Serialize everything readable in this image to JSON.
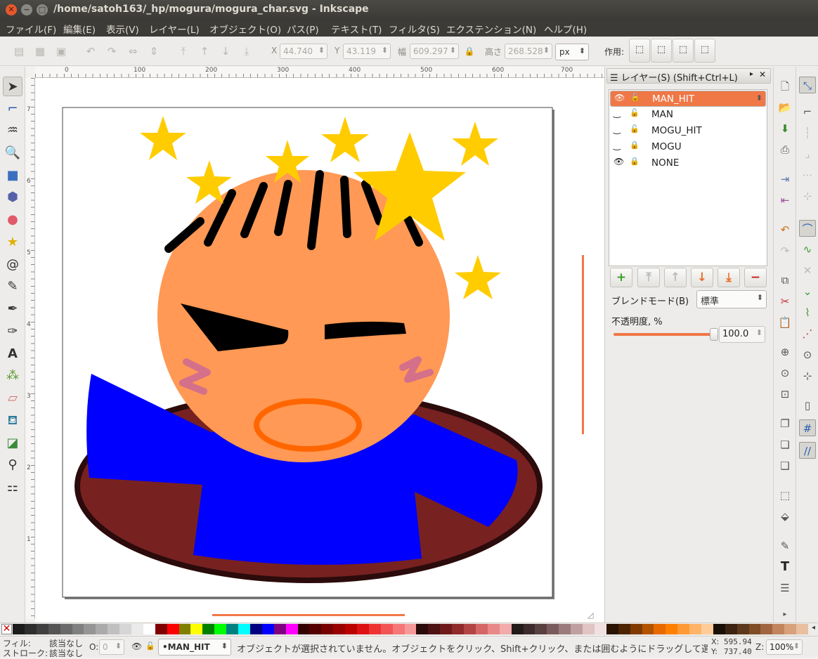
{
  "window": {
    "title": "/home/satoh163/_hp/mogura/mogura_char.svg - Inkscape"
  },
  "menu": [
    "ファイル(F)",
    "編集(E)",
    "表示(V)",
    "レイヤー(L)",
    "オブジェクト(O)",
    "パス(P)",
    "テキスト(T)",
    "フィルタ(S)",
    "エクステンション(N)",
    "ヘルプ(H)"
  ],
  "toolbar": {
    "x_label": "X",
    "x_value": "44.740",
    "y_label": "Y",
    "y_value": "43.119",
    "w_label": "幅",
    "w_value": "609.297",
    "h_label": "高さ",
    "h_value": "268.528",
    "unit": "px",
    "affect_label": "作用:"
  },
  "ruler": {
    "h_ticks": [
      "0",
      "100",
      "200",
      "300",
      "400",
      "500",
      "600",
      "700"
    ],
    "v_ticks": [
      "7",
      "6",
      "5",
      "4",
      "3",
      "2",
      "1"
    ]
  },
  "layers_panel": {
    "title": "レイヤー(S) (Shift+Ctrl+L)",
    "layers": [
      {
        "name": "MAN_HIT",
        "selected": true,
        "visible": true,
        "locked": false
      },
      {
        "name": "MAN",
        "selected": false,
        "visible": false,
        "locked": false
      },
      {
        "name": "MOGU_HIT",
        "selected": false,
        "visible": false,
        "locked": false
      },
      {
        "name": "MOGU",
        "selected": false,
        "visible": false,
        "locked": true
      },
      {
        "name": "NONE",
        "selected": false,
        "visible": true,
        "locked": true
      }
    ],
    "blend_label": "ブレンドモード(B)",
    "blend_value": "標準",
    "opacity_label": "不透明度, %",
    "opacity_value": "100.0",
    "opacity_fraction": 1.0
  },
  "palette": [
    "#1c1c1c",
    "#2e2e2e",
    "#404040",
    "#555555",
    "#6a6a6a",
    "#808080",
    "#959595",
    "#aaaaaa",
    "#c0c0c0",
    "#d5d5d5",
    "#eaeaea",
    "#ffffff",
    "#800000",
    "#ff0000",
    "#808000",
    "#ffff00",
    "#008000",
    "#00ff00",
    "#008080",
    "#00ffff",
    "#000080",
    "#0000ff",
    "#800080",
    "#ff00ff",
    "#330000",
    "#550000",
    "#770000",
    "#990000",
    "#bb0000",
    "#dd1111",
    "#ee3333",
    "#f25555",
    "#f57777",
    "#f89999",
    "#2b0a0a",
    "#4d1212",
    "#6f1a1a",
    "#912a2a",
    "#b34444",
    "#d56666",
    "#e88888",
    "#f2aaaa",
    "#231a1a",
    "#3d2b2b",
    "#594040",
    "#7a5b5b",
    "#9c7b7b",
    "#bf9f9f",
    "#e0c4c4",
    "#f0e0e0",
    "#2a1300",
    "#4d2300",
    "#803a00",
    "#b35200",
    "#e66a00",
    "#ff7f00",
    "#ff9933",
    "#ffb366",
    "#ffcc99",
    "#1a0f05",
    "#3d2410",
    "#5e381a",
    "#7f4d26",
    "#a06440",
    "#c2845c",
    "#d9a07c",
    "#e8bf9f"
  ],
  "status": {
    "fill_label": "フィル:",
    "fill_value": "該当なし",
    "stroke_label": "ストローク:",
    "stroke_value": "該当なし",
    "opacity_label": "O:",
    "opacity_value": "0",
    "layer": "•MAN_HIT",
    "message": "オブジェクトが選択されていません。オブジェクトをクリック、Shift+クリック、または囲むようにドラッグして選択",
    "x_label": "X:",
    "x_value": "595.94",
    "y_label": "Y:",
    "y_value": "737.40",
    "z_label": "Z:",
    "zoom": "100%"
  },
  "colors": {
    "accent": "#f07746",
    "skin": "#ff9955",
    "shirt": "#0000ff",
    "hole": "#782121",
    "star": "#ffcc00",
    "mouth": "#ff6600",
    "cheek": "#d4708a"
  }
}
